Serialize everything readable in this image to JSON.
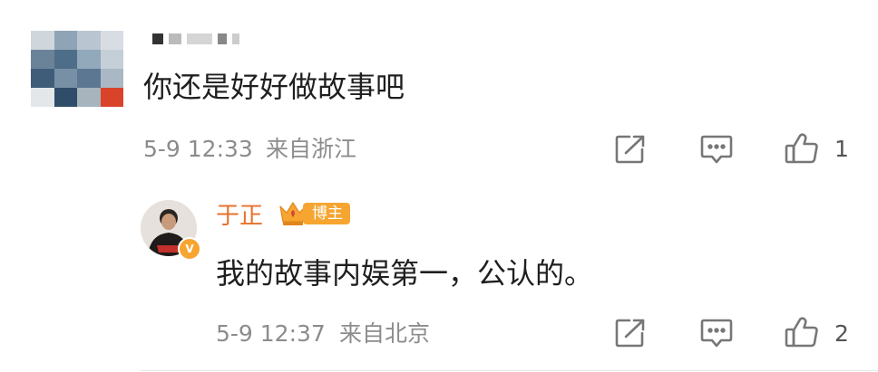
{
  "comment": {
    "user_name": "",
    "text": "你还是好好做故事吧",
    "time": "5-9 12:33",
    "location": "来自浙江",
    "like_count": "1"
  },
  "reply": {
    "user_name": "于正",
    "badge_label": "博主",
    "verified_mark": "V",
    "text": "我的故事内娱第一，公认的。",
    "time": "5-9 12:37",
    "location": "来自北京",
    "like_count": "2"
  },
  "icons": {
    "share": "share-icon",
    "comment": "comment-icon",
    "like": "like-icon",
    "crown": "crown-icon"
  },
  "colors": {
    "author_orange": "#e8702a",
    "badge_orange": "#f6a531",
    "meta_gray": "#8c8c8c"
  }
}
